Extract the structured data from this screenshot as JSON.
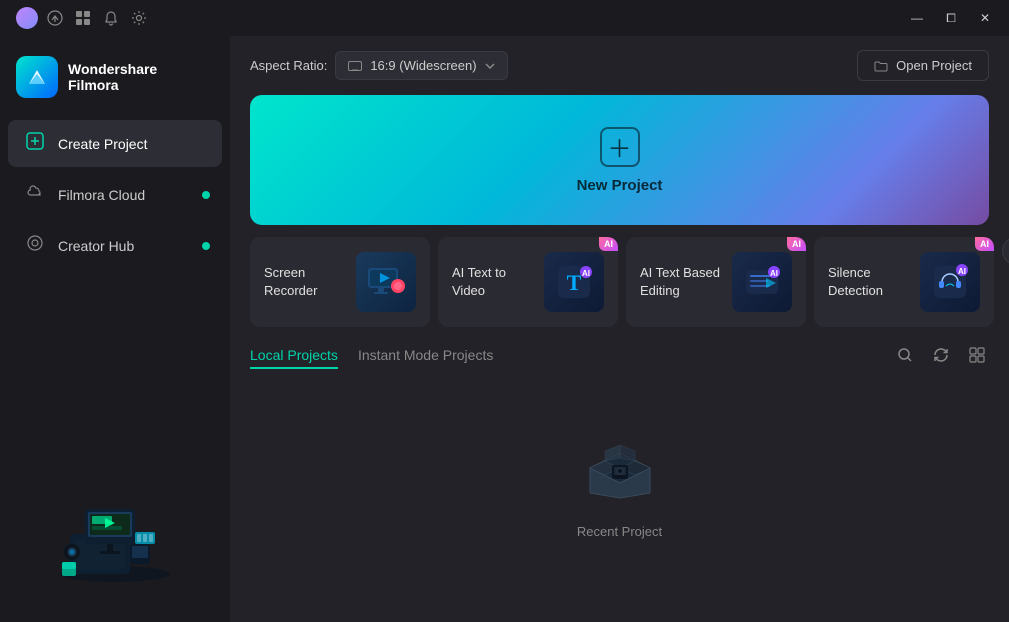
{
  "titlebar": {
    "icons": [
      {
        "name": "avatar-icon",
        "type": "avatar"
      },
      {
        "name": "upload-icon",
        "symbol": "⬆"
      },
      {
        "name": "grid-icon",
        "symbol": "⊞"
      },
      {
        "name": "bell-icon",
        "symbol": "🔔"
      },
      {
        "name": "settings-icon",
        "symbol": "⚙"
      }
    ],
    "buttons": {
      "minimize": "—",
      "maximize": "⧠",
      "close": "✕"
    }
  },
  "sidebar": {
    "logo": {
      "brand": "Wondershare",
      "product": "Filmora"
    },
    "items": [
      {
        "id": "create-project",
        "label": "Create Project",
        "icon": "＋",
        "active": true,
        "dot": false
      },
      {
        "id": "filmora-cloud",
        "label": "Filmora Cloud",
        "icon": "☁",
        "active": false,
        "dot": true
      },
      {
        "id": "creator-hub",
        "label": "Creator Hub",
        "icon": "◎",
        "active": false,
        "dot": true
      }
    ]
  },
  "topbar": {
    "aspect_ratio_label": "Aspect Ratio:",
    "aspect_ratio_value": "16:9 (Widescreen)",
    "open_project_label": "Open Project"
  },
  "new_project": {
    "label": "New Project"
  },
  "feature_cards": [
    {
      "id": "screen-recorder",
      "label": "Screen Recorder",
      "badge": null,
      "icon": "🎬"
    },
    {
      "id": "ai-text-to-video",
      "label": "AI Text to Video",
      "badge": "AI",
      "icon": "🅃"
    },
    {
      "id": "ai-text-based-editing",
      "label": "AI Text Based Editing",
      "badge": "AI",
      "icon": "⌨"
    },
    {
      "id": "silence-detection",
      "label": "Silence Detection",
      "badge": "AI",
      "icon": "🎧"
    }
  ],
  "projects": {
    "tabs": [
      {
        "id": "local-projects",
        "label": "Local Projects",
        "active": true
      },
      {
        "id": "instant-mode",
        "label": "Instant Mode Projects",
        "active": false
      }
    ],
    "empty_label": "Recent Project"
  },
  "colors": {
    "accent": "#00d4aa",
    "background_sidebar": "#1a1a1f",
    "background_content": "#222228",
    "card_bg": "#2a2a32"
  }
}
